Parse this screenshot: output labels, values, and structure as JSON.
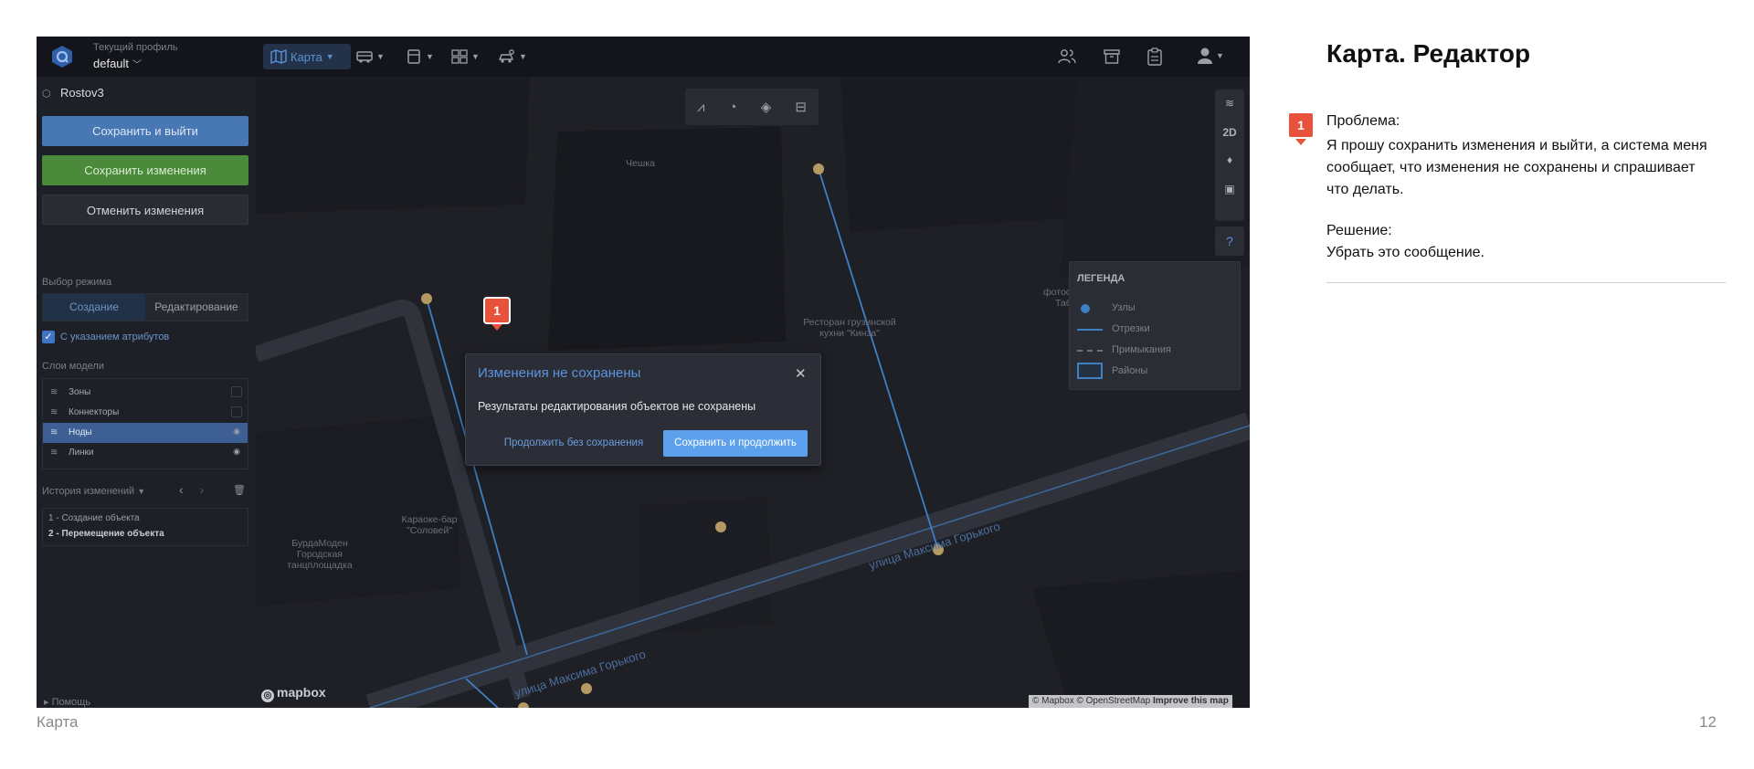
{
  "slide": {
    "title": "Карта. Редактор",
    "footer_section": "Карта",
    "page_number": "12"
  },
  "note": {
    "badge": "1",
    "problem_label": "Проблема:",
    "problem_text": "Я прошу сохранить изменения и выйти, а система меня сообщает, что изменения не сохранены и спрашивает что делать.",
    "solution_label": "Решение:",
    "solution_text": "Убрать это сообщение."
  },
  "app": {
    "topbar": {
      "profile_caption": "Текущий профиль",
      "profile_value": "default",
      "map_tab_label": "Карта",
      "icons": [
        "map-icon",
        "bus-icon",
        "calculator-icon",
        "dashboard-icon",
        "settings-car-icon",
        "users-icon",
        "archive-icon",
        "clipboard-icon",
        "user-avatar-icon"
      ]
    },
    "sidebar": {
      "project_name": "Rostov3",
      "save_exit_label": "Сохранить и выйти",
      "save_label": "Сохранить изменения",
      "cancel_label": "Отменить изменения",
      "mode_label": "Выбор режима",
      "mode_create": "Создание",
      "mode_edit": "Редактирование",
      "attributes_label": "С указанием атрибутов",
      "attributes_checked": true,
      "layers_label": "Слои модели",
      "layers": [
        {
          "name": "Зоны",
          "selected": false
        },
        {
          "name": "Коннекторы",
          "selected": false
        },
        {
          "name": "Ноды",
          "selected": true
        },
        {
          "name": "Линки",
          "selected": false
        }
      ],
      "history_label": "История изменений",
      "history": [
        "1 - Создание объекта",
        "2 - Перемещение объекта"
      ],
      "help_label": "Помощь"
    },
    "map": {
      "right_controls": {
        "view_mode": "2D"
      },
      "legend": {
        "title": "ЛЕГЕНДА",
        "items": [
          "Узлы",
          "Отрезки",
          "Примыкания",
          "Районы"
        ]
      },
      "place_labels": {
        "cheshka": "Чешка",
        "restaurant": "Ресторан грузинской кухни \"Кинза\"",
        "photostudio": "фотостудия",
        "photostudio_cut": "Таб",
        "karaoke": "Караоке-бар \"Соловей\"",
        "burda": "БурдаМоден Городская танцплощадка",
        "street_gorky_1": "улица Максима Горького",
        "street_gorky_2": "улица Максима Горького"
      },
      "mapbox_logo": "mapbox",
      "attribution": "© Mapbox © OpenStreetMap",
      "attribution_link": "Improve this map",
      "colors": {
        "node": "#b49a62",
        "link": "#3f7fc4",
        "road": "#30333c"
      }
    },
    "dialog": {
      "badge": "1",
      "title": "Изменения не сохранены",
      "message": "Результаты редактирования объектов не сохранены",
      "continue_label": "Продолжить без сохранения",
      "save_continue_label": "Сохранить и продолжить"
    }
  }
}
